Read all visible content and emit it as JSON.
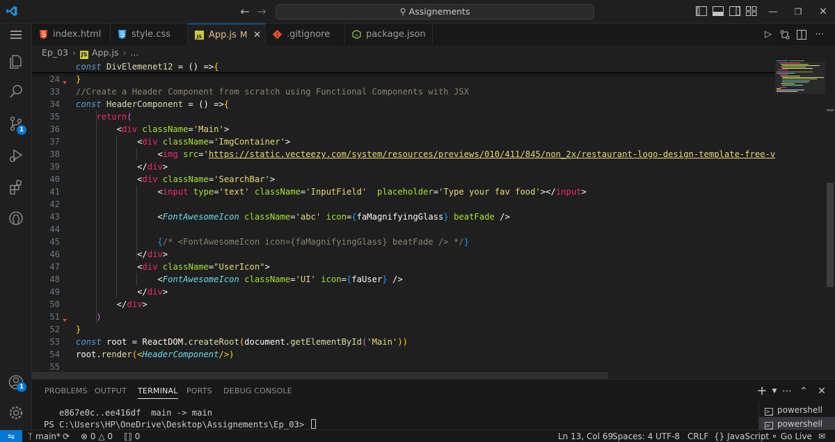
{
  "titlebar": {
    "search_text": "Assignements",
    "back_icon": "arrow-left-icon",
    "forward_icon": "arrow-right-icon"
  },
  "tabs": [
    {
      "label": "index.html",
      "icon": "html-file-icon",
      "active": false
    },
    {
      "label": "style.css",
      "icon": "css-file-icon",
      "active": false
    },
    {
      "label": "App.js",
      "icon": "js-file-icon",
      "active": true,
      "modified": "M"
    },
    {
      "label": ".gitignore",
      "icon": "git-file-icon",
      "active": false
    },
    {
      "label": "package.json",
      "icon": "json-file-icon",
      "active": false
    }
  ],
  "breadcrumb": {
    "folder": "Ep_03",
    "file": "App.js",
    "more": "..."
  },
  "activity": {
    "source_control_badge": "1",
    "accounts_badge": "1"
  },
  "editor": {
    "lines": [
      {
        "n": "24"
      },
      {
        "n": "33"
      },
      {
        "n": "34"
      },
      {
        "n": "35"
      },
      {
        "n": "36"
      },
      {
        "n": "37"
      },
      {
        "n": "38"
      },
      {
        "n": "39"
      },
      {
        "n": "40"
      },
      {
        "n": "41"
      },
      {
        "n": "42"
      },
      {
        "n": "43"
      },
      {
        "n": "44"
      },
      {
        "n": "45"
      },
      {
        "n": "46"
      },
      {
        "n": "47"
      },
      {
        "n": "48"
      },
      {
        "n": "49"
      },
      {
        "n": "50"
      },
      {
        "n": "51"
      },
      {
        "n": "52"
      },
      {
        "n": "53"
      },
      {
        "n": "54"
      },
      {
        "n": "55"
      }
    ],
    "code": {
      "l24": {
        "kw": "const",
        "name": "DivElemenet12",
        "rest": " = () =>",
        "brace": "{"
      },
      "l33": {
        "brace": "}"
      },
      "l34": {
        "comment": "//Create a Header Component from scratch using Functional Components with JSX"
      },
      "l35": {
        "kw": "const",
        "name": "HeaderComponent",
        "rest": " = () =>",
        "brace": "{"
      },
      "l36": {
        "kw": "return",
        "paren": "("
      },
      "l37": {
        "lt": "<",
        "tag": "div",
        "attr": "className",
        "eq": "=",
        "val": "'Main'",
        "gt": ">"
      },
      "l38": {
        "lt": "<",
        "tag": "div",
        "attr": "className",
        "eq": "=",
        "val": "'ImgContainer'",
        "gt": ">"
      },
      "l39": {
        "lt": "<",
        "tag": "img",
        "attr": "src",
        "eq": "=",
        "q": "'",
        "url": "https://static.vecteezy.com/system/resources/previews/010/411/845/non_2x/restaurant-logo-design-template-free-vec"
      },
      "l40": {
        "close": "</",
        "tag": "div",
        "gt": ">"
      },
      "l41": {
        "lt": "<",
        "tag": "div",
        "attr": "className",
        "eq": "=",
        "val": "'SearchBar'",
        "gt": ">"
      },
      "l42": {
        "lt": "<",
        "tag": "input",
        "attr1": "type",
        "val1": "'text'",
        "attr2": "className",
        "val2": "'InputField'",
        "attr3": "placeholder",
        "val3": "'Type your fav food'",
        "end": "></",
        "tag2": "input",
        "gt": ">"
      },
      "l44": {
        "lt": "<",
        "comp": "FontAwesomeIcon",
        "attr1": "className",
        "val1": "'abc'",
        "attr2": "icon",
        "br_open": "{",
        "ref": "faMagnifyingGlass",
        "br_close": "}",
        "attr3": "beatFade",
        "end": " />"
      },
      "l46": {
        "br_open": "{",
        "comment": "/* <FontAwesomeIcon icon={faMagnifyingGlass} beatFade /> */",
        "br_close": "}"
      },
      "l47": {
        "close": "</",
        "tag": "div",
        "gt": ">"
      },
      "l48": {
        "lt": "<",
        "tag": "div",
        "attr": "className",
        "eq": "=",
        "val": "\"UserIcon\"",
        "gt": ">"
      },
      "l49": {
        "lt": "<",
        "comp": "FontAwesomeIcon",
        "attr1": "className",
        "val1": "'UI'",
        "attr2": "icon",
        "br_open": "{",
        "ref": "faUser",
        "br_close": "}",
        "end": " />"
      },
      "l50": {
        "close": "</",
        "tag": "div",
        "gt": ">"
      },
      "l51": {
        "close": "</",
        "tag": "div",
        "gt": ">"
      },
      "l52": {
        "paren": ")"
      },
      "l53": {
        "brace": "}"
      },
      "l54": {
        "kw": "const",
        "var": "root",
        "eq": " = ",
        "obj": "ReactDOM",
        "dot": ".",
        "m1": "createRoot",
        "p1": "(",
        "doc": "document",
        "m2": "getElementById",
        "p2": "(",
        "str": "'Main'",
        "close": "))"
      },
      "l55": {
        "var": "root",
        "dot": ".",
        "m": "render",
        "p1": "(<",
        "comp": "HeaderComponent",
        "end": "/>)"
      }
    }
  },
  "panel": {
    "tabs": [
      "PROBLEMS",
      "OUTPUT",
      "TERMINAL",
      "PORTS",
      "DEBUG CONSOLE"
    ],
    "active_tab": "TERMINAL",
    "terminal_lines": [
      "   e867e0c..ee416df  main -> main",
      "PS C:\\Users\\HP\\OneDrive\\Desktop\\Assignements\\Ep_03> "
    ],
    "terminals": [
      "powershell",
      "powershell"
    ]
  },
  "statusbar": {
    "branch": "main*",
    "errors": "0",
    "warnings": "0",
    "ports": "0",
    "position": "Ln 13, Col 69",
    "spaces": "Spaces: 4",
    "encoding": "UTF-8",
    "eol": "CRLF",
    "language": "JavaScript",
    "golive": "Go Live"
  },
  "colors": {
    "accent": "#0078d4",
    "editor_bg": "#1f1f1f",
    "keyword": "#569cd6",
    "tag": "#f92672",
    "attribute": "#a6e22e",
    "string": "#e6db74"
  }
}
